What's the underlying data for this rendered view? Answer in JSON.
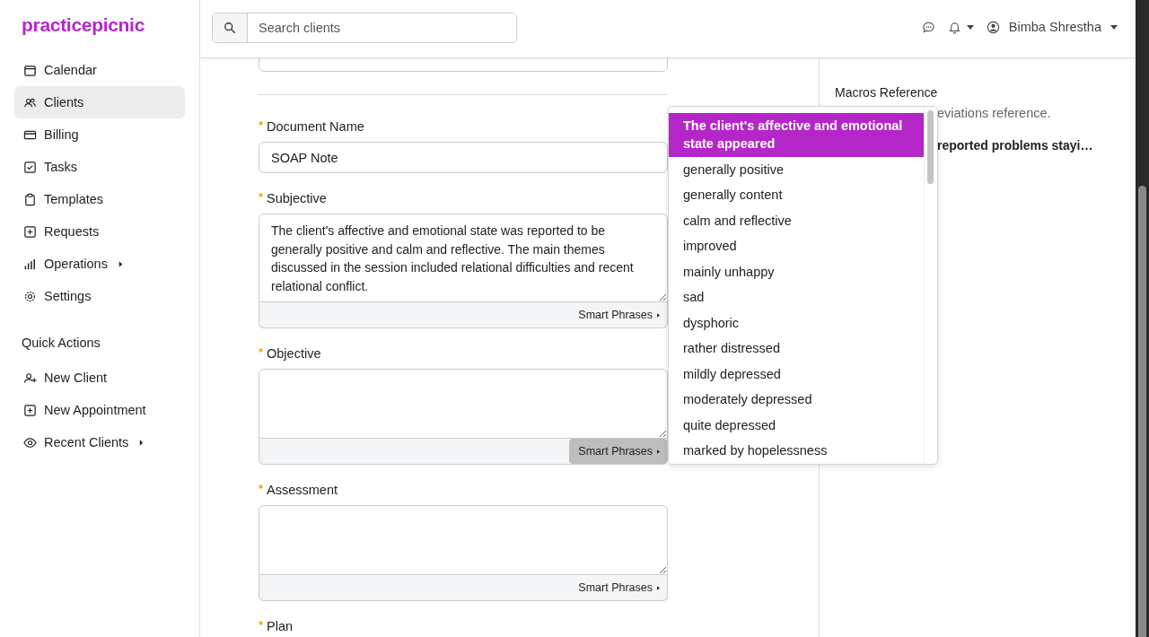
{
  "logo": "practicepicnic",
  "sidebar": {
    "items": [
      {
        "label": "Calendar",
        "selected": false,
        "submenu": false
      },
      {
        "label": "Clients",
        "selected": true,
        "submenu": false
      },
      {
        "label": "Billing",
        "selected": false,
        "submenu": false
      },
      {
        "label": "Tasks",
        "selected": false,
        "submenu": false
      },
      {
        "label": "Templates",
        "selected": false,
        "submenu": false
      },
      {
        "label": "Requests",
        "selected": false,
        "submenu": false
      },
      {
        "label": "Operations",
        "selected": false,
        "submenu": true
      },
      {
        "label": "Settings",
        "selected": false,
        "submenu": false
      }
    ],
    "quick_actions": {
      "title": "Quick Actions",
      "items": [
        {
          "label": "New Client",
          "submenu": false
        },
        {
          "label": "New Appointment",
          "submenu": false
        },
        {
          "label": "Recent Clients",
          "submenu": true
        }
      ]
    }
  },
  "header": {
    "search": {
      "placeholder": "Search clients"
    },
    "user": "Bimba Shrestha"
  },
  "form": {
    "sections": [
      {
        "label": "Document Name",
        "required": true,
        "kind": "input",
        "value": "SOAP Note"
      },
      {
        "label": "Subjective",
        "required": true,
        "kind": "textarea",
        "value": "The client's affective and emotional state was reported to be generally positive and calm and reflective. The main themes discussed in the session included relational difficulties and recent relational conflict.",
        "button": {
          "label": "Smart Phrases",
          "selected": false
        }
      },
      {
        "label": "Objective",
        "required": true,
        "kind": "textarea",
        "button": {
          "label": "Smart Phrases",
          "selected": true
        }
      },
      {
        "label": "Assessment",
        "required": true,
        "kind": "textarea",
        "button": {
          "label": "Smart Phrases",
          "selected": false
        }
      },
      {
        "label": "Plan",
        "required": true,
        "kind": "label"
      }
    ]
  },
  "smart_phrases_menu": {
    "items": [
      {
        "label": "The client's affective and emotional state appeared",
        "selected": true
      },
      {
        "label": "generally positive",
        "selected": false
      },
      {
        "label": "generally content",
        "selected": false
      },
      {
        "label": "calm and reflective",
        "selected": false
      },
      {
        "label": "improved",
        "selected": false
      },
      {
        "label": "mainly unhappy",
        "selected": false
      },
      {
        "label": "sad",
        "selected": false
      },
      {
        "label": "dysphoric",
        "selected": false
      },
      {
        "label": "rather distressed",
        "selected": false
      },
      {
        "label": "mildly depressed",
        "selected": false
      },
      {
        "label": "moderately depressed",
        "selected": false
      },
      {
        "label": "quite depressed",
        "selected": false
      },
      {
        "label": "marked by hopelessness",
        "selected": false
      }
    ]
  },
  "right_panel": {
    "title": "Macros Reference",
    "description": "eviations reference.",
    "macro": "reported problems stayi…"
  }
}
